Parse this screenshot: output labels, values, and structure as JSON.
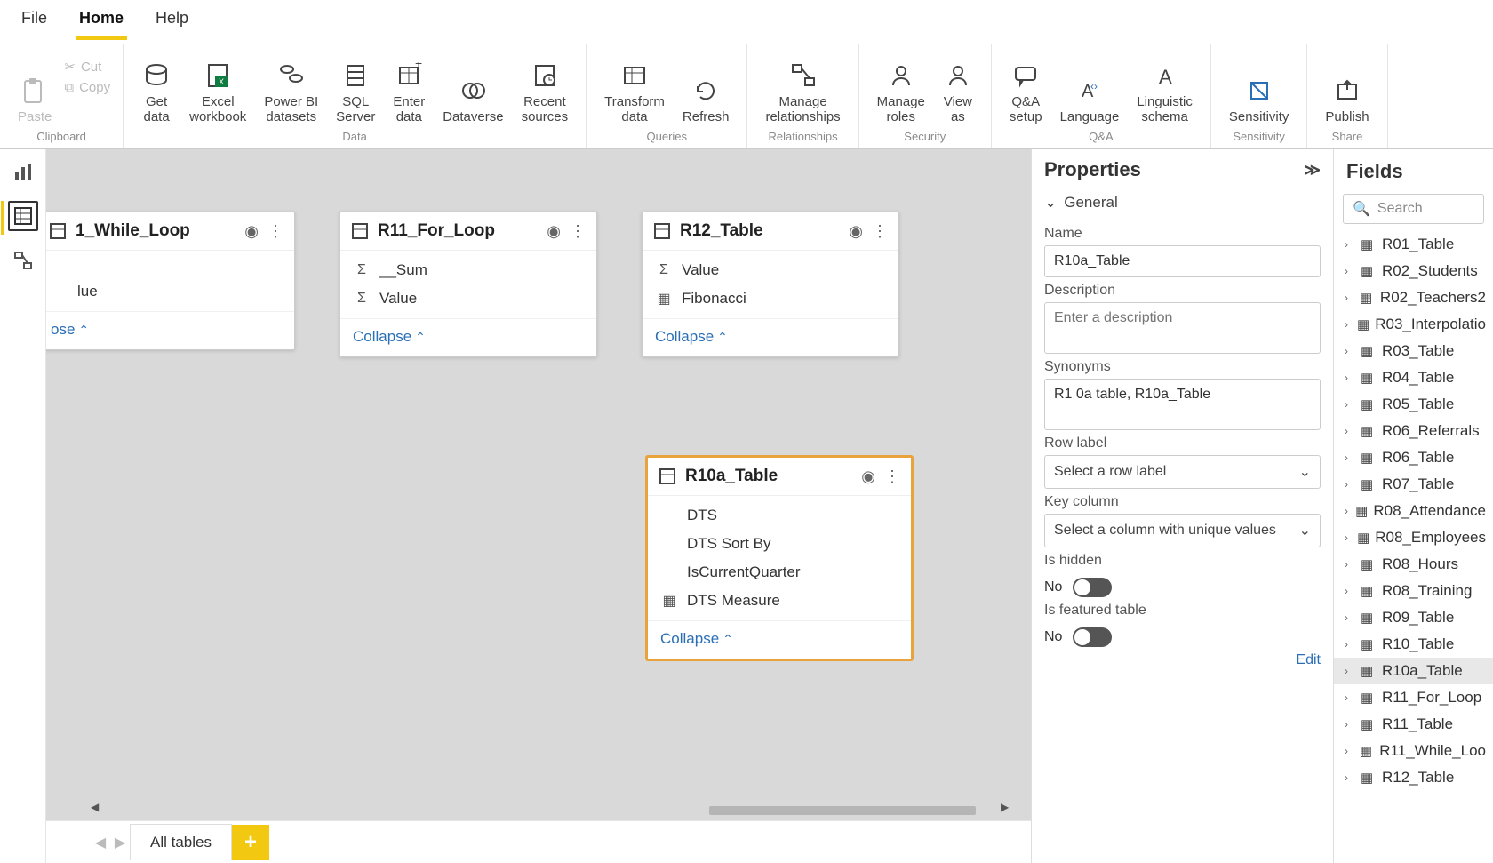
{
  "menu": {
    "file": "File",
    "home": "Home",
    "help": "Help"
  },
  "ribbon": {
    "clipboard": {
      "paste": "Paste",
      "cut": "Cut",
      "copy": "Copy",
      "caption": "Clipboard"
    },
    "data": {
      "get": "Get\ndata",
      "excel": "Excel\nworkbook",
      "pbi": "Power BI\ndatasets",
      "sql": "SQL\nServer",
      "enter": "Enter\ndata",
      "dataverse": "Dataverse",
      "recent": "Recent\nsources",
      "caption": "Data"
    },
    "queries": {
      "transform": "Transform\ndata",
      "refresh": "Refresh",
      "caption": "Queries"
    },
    "relationships": {
      "manage": "Manage\nrelationships",
      "caption": "Relationships"
    },
    "security": {
      "roles": "Manage\nroles",
      "viewas": "View\nas",
      "caption": "Security"
    },
    "qa": {
      "setup": "Q&A\nsetup",
      "language": "Language",
      "schema": "Linguistic\nschema",
      "caption": "Q&A"
    },
    "sensitivity": {
      "label": "Sensitivity",
      "caption": "Sensitivity"
    },
    "share": {
      "publish": "Publish",
      "caption": "Share"
    }
  },
  "cards": {
    "while": {
      "title": "1_While_Loop",
      "fields": [
        "",
        "",
        "lue"
      ],
      "collapse": "ose"
    },
    "for": {
      "title": "R11_For_Loop",
      "fields": [
        "__Sum",
        "Value"
      ],
      "collapse": "Collapse"
    },
    "r12": {
      "title": "R12_Table",
      "fields": [
        "Value",
        "Fibonacci"
      ],
      "collapse": "Collapse"
    },
    "r10a": {
      "title": "R10a_Table",
      "fields": [
        "DTS",
        "DTS Sort By",
        "IsCurrentQuarter",
        "DTS Measure"
      ],
      "collapse": "Collapse"
    }
  },
  "tabbar": {
    "sheet": "All tables"
  },
  "props": {
    "title": "Properties",
    "general": "General",
    "name_label": "Name",
    "name_value": "R10a_Table",
    "desc_label": "Description",
    "desc_placeholder": "Enter a description",
    "syn_label": "Synonyms",
    "syn_value": "R1 0a table, R10a_Table",
    "row_label": "Row label",
    "row_placeholder": "Select a row label",
    "key_label": "Key column",
    "key_placeholder": "Select a column with unique values",
    "hidden_label": "Is hidden",
    "hidden_value": "No",
    "featured_label": "Is featured table",
    "featured_value": "No",
    "edit": "Edit"
  },
  "fields": {
    "title": "Fields",
    "search_placeholder": "Search",
    "items": [
      "R01_Table",
      "R02_Students",
      "R02_Teachers2",
      "R03_Interpolatio",
      "R03_Table",
      "R04_Table",
      "R05_Table",
      "R06_Referrals",
      "R06_Table",
      "R07_Table",
      "R08_Attendance",
      "R08_Employees",
      "R08_Hours",
      "R08_Training",
      "R09_Table",
      "R10_Table",
      "R10a_Table",
      "R11_For_Loop",
      "R11_Table",
      "R11_While_Loo",
      "R12_Table"
    ],
    "selected": "R10a_Table"
  }
}
